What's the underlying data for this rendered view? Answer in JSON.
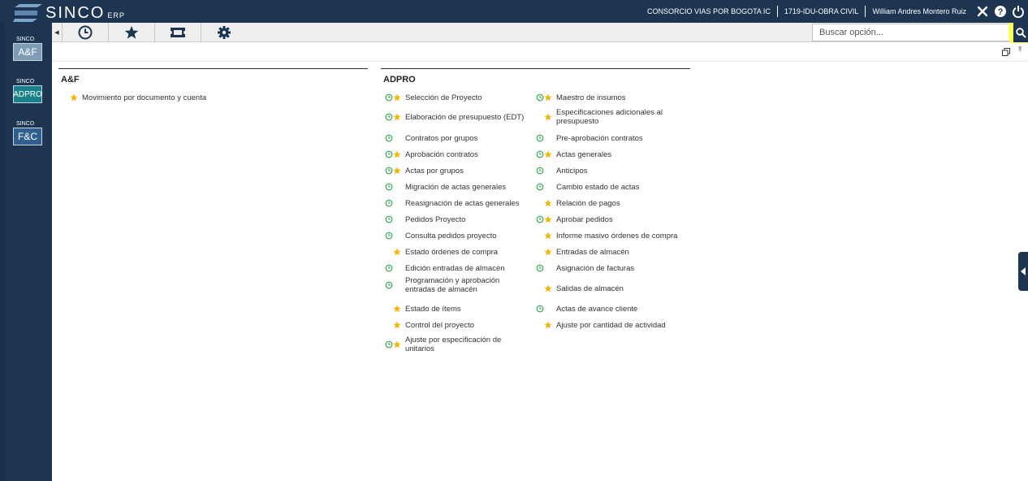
{
  "app": {
    "logo_text": "SINCO",
    "logo_sub": "ERP"
  },
  "header": {
    "company": "CONSORCIO VIAS POR BOGOTA IC",
    "project": "1719-IDU-OBRA CIVIL",
    "user": "William Andres Montero Ruiz"
  },
  "modules": [
    {
      "small": "SINCO",
      "big": "A&F"
    },
    {
      "small": "SINCO",
      "big": "ADPRO"
    },
    {
      "small": "SINCO",
      "big": "F&C"
    }
  ],
  "search": {
    "placeholder": "Buscar opción..."
  },
  "sections": {
    "af": {
      "title": "A&F",
      "items": [
        {
          "label": "Movimiento por documento y cuenta",
          "recent": false,
          "favorite": true
        }
      ]
    },
    "adpro": {
      "title": "ADPRO",
      "col1": [
        {
          "label": "Selección de Proyecto",
          "recent": true,
          "favorite": true
        },
        {
          "label": "Elaboración de presupuesto (EDT)",
          "recent": true,
          "favorite": true
        },
        {
          "label": "Contratos por grupos",
          "recent": true,
          "favorite": false
        },
        {
          "label": "Aprobación contratos",
          "recent": true,
          "favorite": true
        },
        {
          "label": "Actas por grupos",
          "recent": true,
          "favorite": true
        },
        {
          "label": "Migración de actas generales",
          "recent": true,
          "favorite": false
        },
        {
          "label": "Reasignación de actas generales",
          "recent": true,
          "favorite": false
        },
        {
          "label": "Pedidos Proyecto",
          "recent": true,
          "favorite": false
        },
        {
          "label": "Consulta pedidos proyecto",
          "recent": true,
          "favorite": false
        },
        {
          "label": "Estado órdenes de compra",
          "recent": false,
          "favorite": true
        },
        {
          "label": "Edición entradas de almacén",
          "recent": true,
          "favorite": false
        },
        {
          "label": "Programación y aprobación entradas de almacén",
          "recent": true,
          "favorite": false
        },
        {
          "label": "Estado de ítems",
          "recent": false,
          "favorite": true
        },
        {
          "label": "Control del proyecto",
          "recent": false,
          "favorite": true
        },
        {
          "label": "Ajuste por especificación de unitarios",
          "recent": true,
          "favorite": true
        }
      ],
      "col2": [
        {
          "label": "Maestro de insumos",
          "recent": true,
          "favorite": true
        },
        {
          "label": "Especificaciones adicionales al presupuesto",
          "recent": false,
          "favorite": true
        },
        {
          "label": "Pre-aprobación contratos",
          "recent": true,
          "favorite": false
        },
        {
          "label": "Actas generales",
          "recent": true,
          "favorite": true
        },
        {
          "label": "Anticipos",
          "recent": true,
          "favorite": false
        },
        {
          "label": "Cambio estado de actas",
          "recent": true,
          "favorite": false
        },
        {
          "label": "Relación de pagos",
          "recent": false,
          "favorite": true
        },
        {
          "label": "Aprobar pedidos",
          "recent": true,
          "favorite": true
        },
        {
          "label": "Informe masivo órdenes de compra",
          "recent": false,
          "favorite": true
        },
        {
          "label": "Entradas de almacén",
          "recent": false,
          "favorite": true
        },
        {
          "label": "Asignación de facturas",
          "recent": true,
          "favorite": false
        },
        {
          "label": "Salidas de almacén",
          "recent": false,
          "favorite": true
        },
        {
          "label": "Actas de avance cliente",
          "recent": true,
          "favorite": false
        },
        {
          "label": "Ajuste por cantidad de actividad",
          "recent": false,
          "favorite": true
        }
      ]
    }
  },
  "colors": {
    "primary": "#1d3550",
    "recent_icon": "#3aa655",
    "favorite_icon": "#f4b400",
    "af_module": "#7f9cb5",
    "adpro_module": "#17808a",
    "fc_module": "#2f5f8f"
  }
}
